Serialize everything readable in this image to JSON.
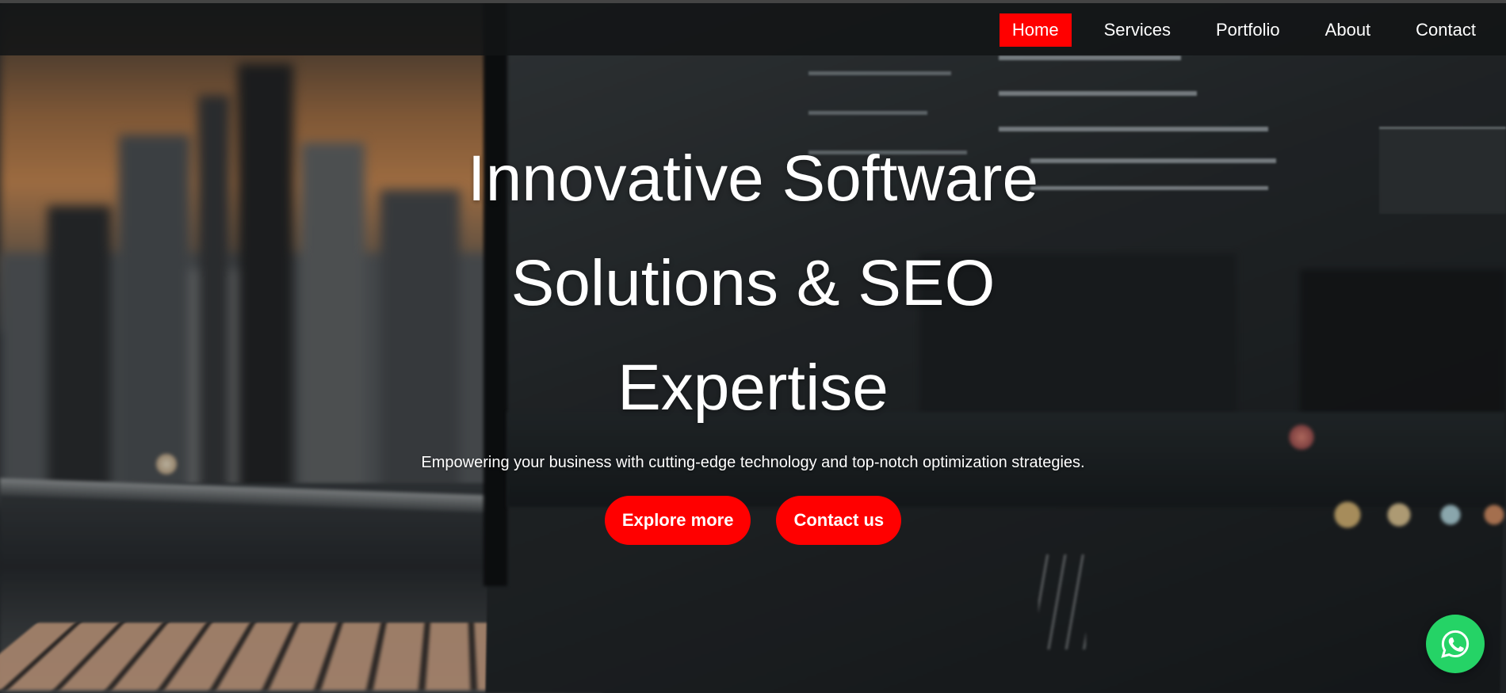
{
  "nav": {
    "items": [
      {
        "label": "Home",
        "active": true
      },
      {
        "label": "Services",
        "active": false
      },
      {
        "label": "Portfolio",
        "active": false
      },
      {
        "label": "About",
        "active": false
      },
      {
        "label": "Contact",
        "active": false
      }
    ]
  },
  "hero": {
    "title": "Innovative Software Solutions & SEO Expertise",
    "subtitle": "Empowering your business with cutting-edge technology and top-notch optimization strategies.",
    "primary_cta": "Explore more",
    "secondary_cta": "Contact us",
    "background": "laptop-code-city-photo"
  },
  "floating": {
    "icon": "whatsapp-icon"
  },
  "colors": {
    "accent": "#ff0000",
    "whatsapp": "#25d366",
    "nav_bg": "#121416",
    "text": "#ffffff"
  }
}
